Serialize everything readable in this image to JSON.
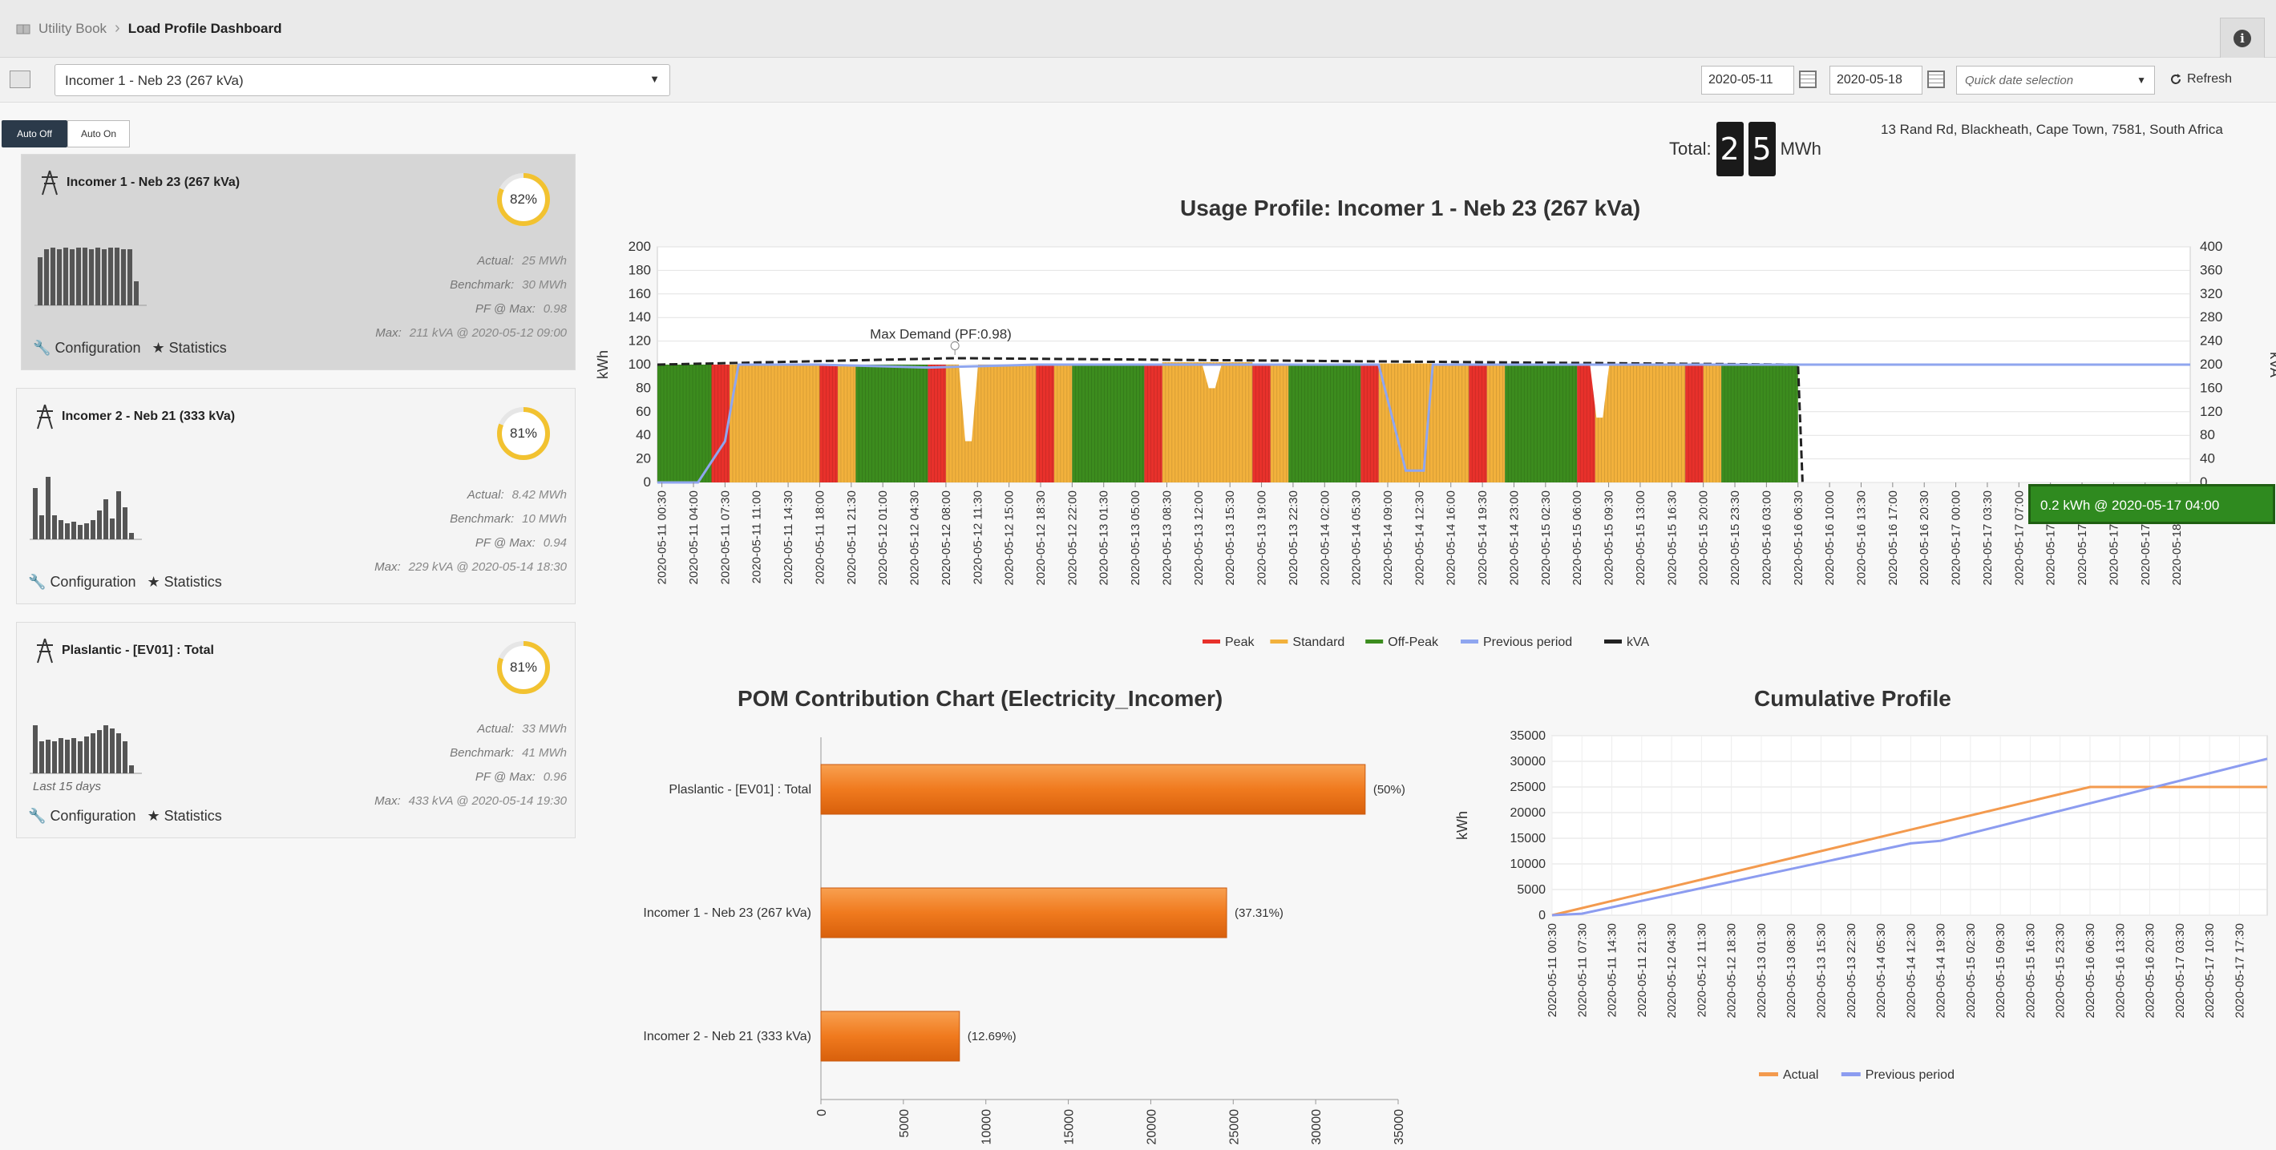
{
  "breadcrumb": {
    "home": "Utility Book",
    "current": "Load Profile Dashboard"
  },
  "toolbar": {
    "meter": "Incomer 1 - Neb 23 (267 kVa)",
    "date_from": "2020-05-11",
    "date_to": "2020-05-18",
    "quick_placeholder": "Quick date selection",
    "refresh": "Refresh"
  },
  "auto": {
    "off": "Auto Off",
    "on": "Auto On"
  },
  "cards": [
    {
      "title": "Incomer 1 - Neb 23 (267 kVa)",
      "percent": 82,
      "percent_label": "82%",
      "actual_label": "Actual:",
      "actual": "25 MWh",
      "benchmark_label": "Benchmark:",
      "benchmark": "30 MWh",
      "pf_label": "PF @ Max:",
      "pf": "0.98",
      "max_label": "Max:",
      "max": "211 kVA @ 2020-05-12 09:00",
      "config": "Configuration",
      "statistics": "Statistics",
      "sub": "",
      "spark": [
        60,
        70,
        72,
        70,
        72,
        70,
        72,
        72,
        70,
        72,
        70,
        72,
        72,
        70,
        70,
        30
      ]
    },
    {
      "title": "Incomer 2 - Neb 21 (333 kVa)",
      "percent": 81,
      "percent_label": "81%",
      "actual_label": "Actual:",
      "actual": "8.42 MWh",
      "benchmark_label": "Benchmark:",
      "benchmark": "10 MWh",
      "pf_label": "PF @ Max:",
      "pf": "0.94",
      "max_label": "Max:",
      "max": "229 kVA @ 2020-05-14 18:30",
      "config": "Configuration",
      "statistics": "Statistics",
      "sub": "",
      "spark": [
        64,
        30,
        78,
        30,
        24,
        20,
        22,
        18,
        20,
        24,
        36,
        50,
        26,
        60,
        40,
        8
      ]
    },
    {
      "title": "Plaslantic - [EV01] : Total",
      "percent": 81,
      "percent_label": "81%",
      "actual_label": "Actual:",
      "actual": "33 MWh",
      "benchmark_label": "Benchmark:",
      "benchmark": "41 MWh",
      "pf_label": "PF @ Max:",
      "pf": "0.96",
      "max_label": "Max:",
      "max": "433 kVA @ 2020-05-14 19:30",
      "config": "Configuration",
      "statistics": "Statistics",
      "sub": "Last 15 days",
      "spark": [
        60,
        40,
        42,
        40,
        44,
        42,
        44,
        40,
        46,
        50,
        54,
        60,
        56,
        50,
        40,
        10
      ]
    }
  ],
  "total": {
    "label": "Total:",
    "digits": [
      "2",
      "5"
    ],
    "unit": "MWh"
  },
  "address": "13 Rand Rd, Blackheath, Cape Town, 7581, South Africa",
  "tooltip": "0.2 kWh @ 2020-05-17 04:00",
  "chart_data": [
    {
      "type": "bar",
      "title": "Usage Profile: Incomer 1 - Neb 23 (267 kVa)",
      "ylabel": "kWh",
      "y2label": "kVA",
      "ylim": [
        0,
        200
      ],
      "y2lim": [
        0,
        400
      ],
      "yticks": [
        0,
        20,
        40,
        60,
        80,
        100,
        120,
        140,
        160,
        180,
        200
      ],
      "y2ticks": [
        0,
        40,
        80,
        120,
        160,
        200,
        240,
        280,
        320,
        360,
        400
      ],
      "annotation": "Max Demand (PF:0.98)",
      "xticks": [
        "2020-05-11 00:30",
        "2020-05-11 04:00",
        "2020-05-11 07:30",
        "2020-05-11 11:00",
        "2020-05-11 14:30",
        "2020-05-11 18:00",
        "2020-05-11 21:30",
        "2020-05-12 01:00",
        "2020-05-12 04:30",
        "2020-05-12 08:00",
        "2020-05-12 11:30",
        "2020-05-12 15:00",
        "2020-05-12 18:30",
        "2020-05-12 22:00",
        "2020-05-13 01:30",
        "2020-05-13 05:00",
        "2020-05-13 08:30",
        "2020-05-13 12:00",
        "2020-05-13 15:30",
        "2020-05-13 19:00",
        "2020-05-13 22:30",
        "2020-05-14 02:00",
        "2020-05-14 05:30",
        "2020-05-14 09:00",
        "2020-05-14 12:30",
        "2020-05-14 16:00",
        "2020-05-14 19:30",
        "2020-05-14 23:00",
        "2020-05-15 02:30",
        "2020-05-15 06:00",
        "2020-05-15 09:30",
        "2020-05-15 13:00",
        "2020-05-15 16:30",
        "2020-05-15 20:00",
        "2020-05-15 23:30",
        "2020-05-16 03:00",
        "2020-05-16 06:30",
        "2020-05-16 10:00",
        "2020-05-16 13:30",
        "2020-05-16 17:00",
        "2020-05-16 20:30",
        "2020-05-17 00:00",
        "2020-05-17 03:30",
        "2020-05-17 07:00",
        "2020-05-17 10:30",
        "2020-05-17 14:00",
        "2020-05-17 17:30",
        "2020-05-17 21:00",
        "2020-05-18 00:30"
      ],
      "segments": [
        {
          "tariff": "Off-Peak",
          "from": "2020-05-11 00:00",
          "to": "2020-05-11 06:00",
          "value": 100
        },
        {
          "tariff": "Peak",
          "from": "2020-05-11 06:00",
          "to": "2020-05-11 08:00",
          "value": 100
        },
        {
          "tariff": "Standard",
          "from": "2020-05-11 08:00",
          "to": "2020-05-11 18:00",
          "value": 100
        },
        {
          "tariff": "Peak",
          "from": "2020-05-11 18:00",
          "to": "2020-05-11 20:00",
          "value": 100
        },
        {
          "tariff": "Standard",
          "from": "2020-05-11 20:00",
          "to": "2020-05-11 22:00",
          "value": 100
        },
        {
          "tariff": "Off-Peak",
          "from": "2020-05-11 22:00",
          "to": "2020-05-12 06:00",
          "value": 100
        },
        {
          "tariff": "Peak",
          "from": "2020-05-12 06:00",
          "to": "2020-05-12 08:00",
          "value": 100
        },
        {
          "tariff": "Standard",
          "from": "2020-05-12 08:00",
          "to": "2020-05-12 18:00",
          "value": 100
        },
        {
          "tariff": "Peak",
          "from": "2020-05-12 18:00",
          "to": "2020-05-12 20:00",
          "value": 100
        },
        {
          "tariff": "Standard",
          "from": "2020-05-12 20:00",
          "to": "2020-05-12 22:00",
          "value": 100
        },
        {
          "tariff": "Off-Peak",
          "from": "2020-05-12 22:00",
          "to": "2020-05-13 06:00",
          "value": 100
        },
        {
          "tariff": "Peak",
          "from": "2020-05-13 06:00",
          "to": "2020-05-13 08:00",
          "value": 100
        },
        {
          "tariff": "Standard",
          "from": "2020-05-13 08:00",
          "to": "2020-05-13 18:00",
          "value": 102
        },
        {
          "tariff": "Peak",
          "from": "2020-05-13 18:00",
          "to": "2020-05-13 20:00",
          "value": 100
        },
        {
          "tariff": "Standard",
          "from": "2020-05-13 20:00",
          "to": "2020-05-13 22:00",
          "value": 100
        },
        {
          "tariff": "Off-Peak",
          "from": "2020-05-13 22:00",
          "to": "2020-05-14 06:00",
          "value": 100
        },
        {
          "tariff": "Peak",
          "from": "2020-05-14 06:00",
          "to": "2020-05-14 08:00",
          "value": 100
        },
        {
          "tariff": "Standard",
          "from": "2020-05-14 08:00",
          "to": "2020-05-14 18:00",
          "value": 101
        },
        {
          "tariff": "Peak",
          "from": "2020-05-14 18:00",
          "to": "2020-05-14 20:00",
          "value": 100
        },
        {
          "tariff": "Standard",
          "from": "2020-05-14 20:00",
          "to": "2020-05-14 22:00",
          "value": 100
        },
        {
          "tariff": "Off-Peak",
          "from": "2020-05-14 22:00",
          "to": "2020-05-15 06:00",
          "value": 101
        },
        {
          "tariff": "Peak",
          "from": "2020-05-15 06:00",
          "to": "2020-05-15 08:00",
          "value": 100
        },
        {
          "tariff": "Standard",
          "from": "2020-05-15 08:00",
          "to": "2020-05-15 18:00",
          "value": 100
        },
        {
          "tariff": "Peak",
          "from": "2020-05-15 18:00",
          "to": "2020-05-15 20:00",
          "value": 100
        },
        {
          "tariff": "Standard",
          "from": "2020-05-15 20:00",
          "to": "2020-05-15 22:00",
          "value": 100
        },
        {
          "tariff": "Off-Peak",
          "from": "2020-05-15 22:00",
          "to": "2020-05-16 06:30",
          "value": 100
        }
      ],
      "kva_line_points": [
        [
          "2020-05-11 00:00",
          200
        ],
        [
          "2020-05-12 09:00",
          211
        ],
        [
          "2020-05-16 06:30",
          200
        ],
        [
          "2020-05-16 07:00",
          1
        ]
      ],
      "previous_period_points": [
        [
          "2020-05-11 00:00",
          0
        ],
        [
          "2020-05-11 04:30",
          0
        ],
        [
          "2020-05-11 07:30",
          70
        ],
        [
          "2020-05-11 09:00",
          200
        ],
        [
          "2020-05-11 18:00",
          200
        ],
        [
          "2020-05-12 06:00",
          195
        ],
        [
          "2020-05-12 18:00",
          200
        ],
        [
          "2020-05-13 12:00",
          200
        ],
        [
          "2020-05-14 08:00",
          200
        ],
        [
          "2020-05-14 11:00",
          20
        ],
        [
          "2020-05-14 13:00",
          20
        ],
        [
          "2020-05-14 14:00",
          200
        ],
        [
          "2020-05-15 12:00",
          200
        ],
        [
          "2020-05-16 12:00",
          200
        ],
        [
          "2020-05-17 00:00",
          200
        ],
        [
          "2020-05-18 02:00",
          200
        ]
      ],
      "legend": [
        "Peak",
        "Standard",
        "Off-Peak",
        "Previous period",
        "kVA"
      ],
      "colors": {
        "Peak": "#e8312b",
        "Standard": "#f2b13c",
        "Off-Peak": "#3c8c1e",
        "Previous period": "#8fa6ef",
        "kVA": "#222222"
      }
    },
    {
      "type": "bar",
      "orientation": "horizontal",
      "title": "POM Contribution Chart (Electricity_Incomer)",
      "categories": [
        "Plaslantic - [EV01] : Total",
        "Incomer 1 - Neb 23 (267 kVa)",
        "Incomer 2 - Neb 21 (333 kVa)"
      ],
      "values": [
        33000,
        24600,
        8400
      ],
      "labels": [
        "(50%)",
        "(37.31%)",
        "(12.69%)"
      ],
      "xlim": [
        0,
        35000
      ],
      "xticks": [
        0,
        5000,
        10000,
        15000,
        20000,
        25000,
        30000,
        35000
      ],
      "color": "#f07a1e"
    },
    {
      "type": "line",
      "title": "Cumulative Profile",
      "ylabel": "kWh",
      "ylim": [
        0,
        35000
      ],
      "yticks": [
        0,
        5000,
        10000,
        15000,
        20000,
        25000,
        30000,
        35000
      ],
      "xticks": [
        "2020-05-11 00:30",
        "2020-05-11 07:30",
        "2020-05-11 14:30",
        "2020-05-11 21:30",
        "2020-05-12 04:30",
        "2020-05-12 11:30",
        "2020-05-12 18:30",
        "2020-05-13 01:30",
        "2020-05-13 08:30",
        "2020-05-13 15:30",
        "2020-05-13 22:30",
        "2020-05-14 05:30",
        "2020-05-14 12:30",
        "2020-05-14 19:30",
        "2020-05-15 02:30",
        "2020-05-15 09:30",
        "2020-05-15 16:30",
        "2020-05-15 23:30",
        "2020-05-16 06:30",
        "2020-05-16 13:30",
        "2020-05-16 20:30",
        "2020-05-17 03:30",
        "2020-05-17 10:30",
        "2020-05-17 17:30"
      ],
      "series": [
        {
          "name": "Actual",
          "color": "#f39a4e",
          "points": [
            [
              "2020-05-11 00:30",
              0
            ],
            [
              "2020-05-16 06:30",
              25000
            ],
            [
              "2020-05-18 00:00",
              25000
            ]
          ]
        },
        {
          "name": "Previous period",
          "color": "#8c9cf0",
          "points": [
            [
              "2020-05-11 00:30",
              0
            ],
            [
              "2020-05-11 07:30",
              300
            ],
            [
              "2020-05-14 12:30",
              14000
            ],
            [
              "2020-05-14 19:30",
              14500
            ],
            [
              "2020-05-18 00:00",
              30500
            ]
          ]
        }
      ]
    }
  ]
}
